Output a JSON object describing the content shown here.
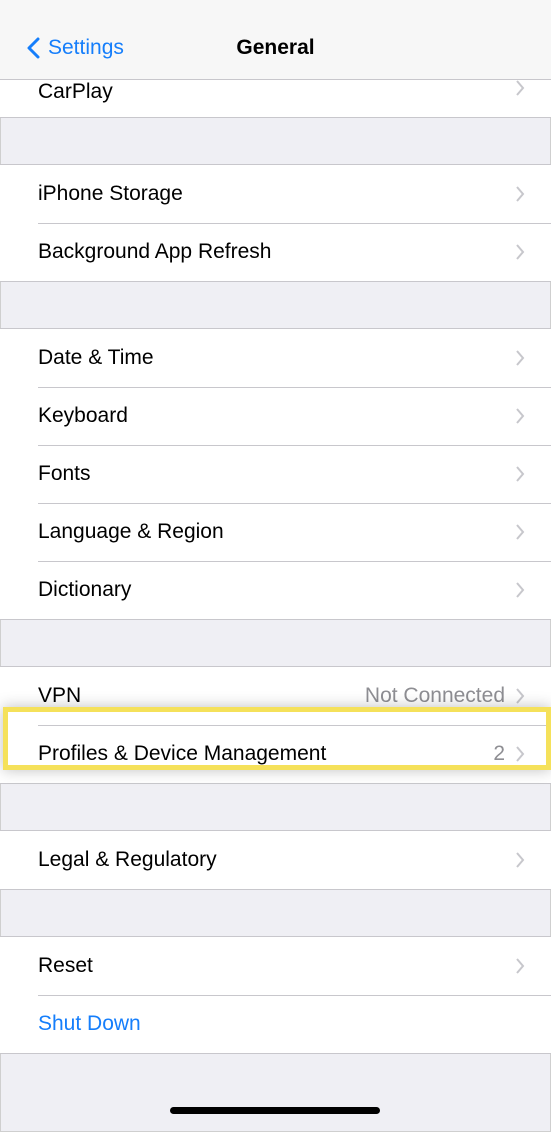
{
  "nav": {
    "back_label": "Settings",
    "title": "General"
  },
  "groups": [
    {
      "rows": [
        {
          "label": "CarPlay",
          "value": "",
          "chevron": true
        }
      ]
    },
    {
      "rows": [
        {
          "label": "iPhone Storage",
          "value": "",
          "chevron": true
        },
        {
          "label": "Background App Refresh",
          "value": "",
          "chevron": true
        }
      ]
    },
    {
      "rows": [
        {
          "label": "Date & Time",
          "value": "",
          "chevron": true
        },
        {
          "label": "Keyboard",
          "value": "",
          "chevron": true
        },
        {
          "label": "Fonts",
          "value": "",
          "chevron": true
        },
        {
          "label": "Language & Region",
          "value": "",
          "chevron": true
        },
        {
          "label": "Dictionary",
          "value": "",
          "chevron": true
        }
      ]
    },
    {
      "rows": [
        {
          "label": "VPN",
          "value": "Not Connected",
          "chevron": true
        },
        {
          "label": "Profiles & Device Management",
          "value": "2",
          "chevron": true
        }
      ]
    },
    {
      "rows": [
        {
          "label": "Legal & Regulatory",
          "value": "",
          "chevron": true
        }
      ]
    },
    {
      "rows": [
        {
          "label": "Reset",
          "value": "",
          "chevron": true
        },
        {
          "label": "Shut Down",
          "value": "",
          "chevron": false
        }
      ]
    }
  ],
  "colors": {
    "accent": "#157efb",
    "highlight": "#f5e15a",
    "background": "#efeff4",
    "secondary_text": "#8e8e93"
  }
}
